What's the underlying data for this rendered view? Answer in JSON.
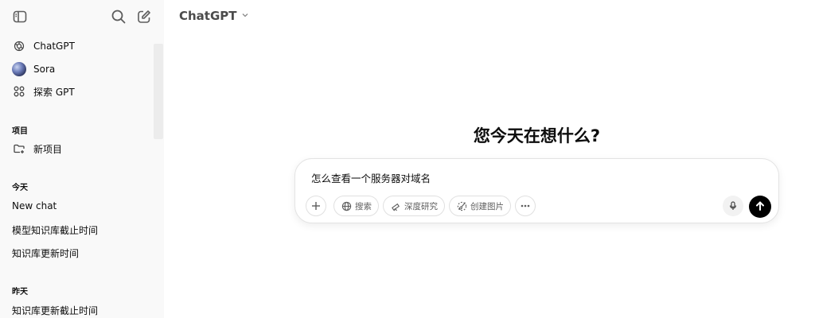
{
  "sidebar": {
    "toggle_icon": "sidebar-toggle-icon",
    "search_icon": "search-icon",
    "new_chat_icon": "edit-icon",
    "nav": [
      {
        "label": "ChatGPT",
        "icon": "openai-logo-icon"
      },
      {
        "label": "Sora",
        "icon": "sora-avatar"
      },
      {
        "label": "探索 GPT",
        "icon": "grid-icon"
      }
    ],
    "projects_heading": "项目",
    "new_project_label": "新项目",
    "today_heading": "今天",
    "today_chats": [
      "New chat",
      "模型知识库截止时间",
      "知识库更新时间"
    ],
    "yesterday_heading": "昨天",
    "yesterday_chats": [
      "知识库更新截止时间"
    ]
  },
  "header": {
    "model_label": "ChatGPT"
  },
  "main": {
    "headline": "您今天在想什么?",
    "composer": {
      "text": "怎么查看一个服务器对域名",
      "tools": [
        {
          "label": "搜索",
          "icon": "globe-icon"
        },
        {
          "label": "深度研究",
          "icon": "telescope-icon"
        },
        {
          "label": "创建图片",
          "icon": "brush-icon"
        }
      ]
    }
  }
}
